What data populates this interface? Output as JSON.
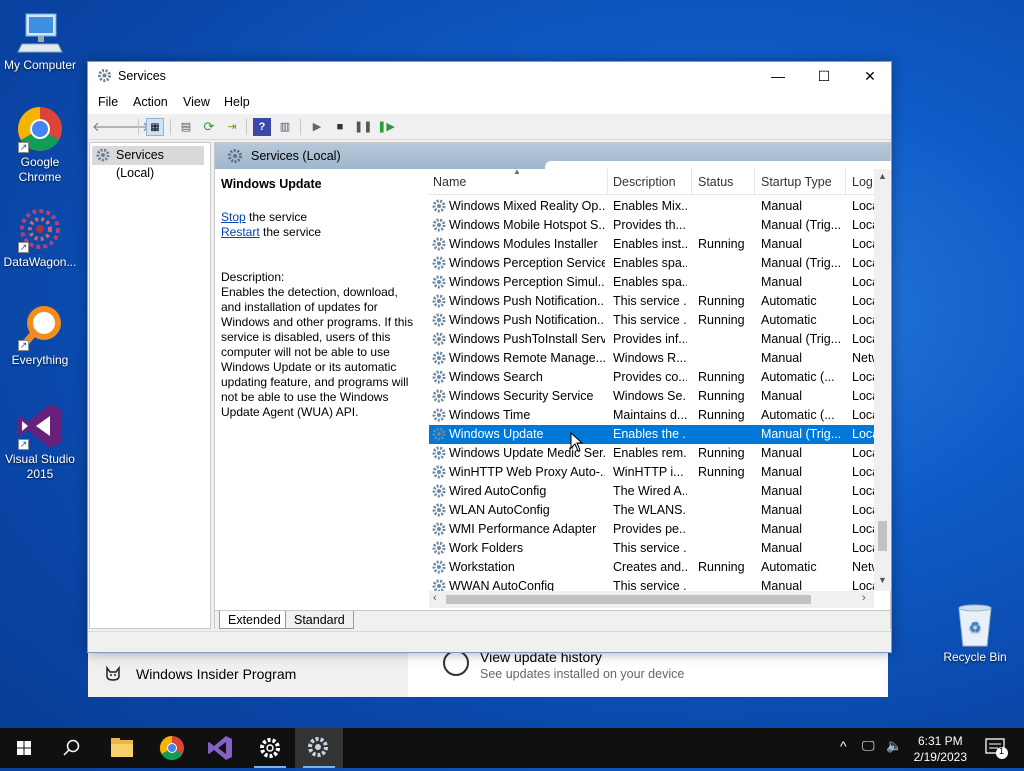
{
  "desktop": {
    "icons": [
      {
        "label": "My Computer",
        "icon": "computer-icon"
      },
      {
        "label": "Google Chrome",
        "icon": "chrome-icon"
      },
      {
        "label": "DataWagon...",
        "icon": "datawagon-icon"
      },
      {
        "label": "Everything",
        "icon": "everything-search-icon"
      },
      {
        "label": "Visual Studio 2015",
        "icon": "visual-studio-icon"
      },
      {
        "label": "Recycle Bin",
        "icon": "recycle-bin-icon"
      }
    ]
  },
  "settings_window": {
    "left_item": "Windows Insider Program",
    "history_title": "View update history",
    "history_subtitle": "See updates installed on your device"
  },
  "services_window": {
    "title": "Services",
    "menu": [
      "File",
      "Action",
      "View",
      "Help"
    ],
    "tree_item": "Services (Local)",
    "pane_title": "Services (Local)",
    "selected_service": {
      "name": "Windows Update",
      "stop_link": "Stop",
      "stop_rest": " the service",
      "restart_link": "Restart",
      "restart_rest": " the service",
      "description_label": "Description:",
      "description": "Enables the detection, download, and installation of updates for Windows and other programs. If this service is disabled, users of this computer will not be able to use Windows Update or its automatic updating feature, and programs will not be able to use the Windows Update Agent (WUA) API."
    },
    "columns": [
      "Name",
      "Description",
      "Status",
      "Startup Type",
      "Log"
    ],
    "rows": [
      {
        "name": "Windows Mixed Reality Op...",
        "desc": "Enables Mix...",
        "status": "",
        "startup": "Manual",
        "log": "Loca"
      },
      {
        "name": "Windows Mobile Hotspot S...",
        "desc": "Provides th...",
        "status": "",
        "startup": "Manual (Trig...",
        "log": "Loca"
      },
      {
        "name": "Windows Modules Installer",
        "desc": "Enables inst...",
        "status": "Running",
        "startup": "Manual",
        "log": "Loca"
      },
      {
        "name": "Windows Perception Service",
        "desc": "Enables spa...",
        "status": "",
        "startup": "Manual (Trig...",
        "log": "Loca"
      },
      {
        "name": "Windows Perception Simul...",
        "desc": "Enables spa...",
        "status": "",
        "startup": "Manual",
        "log": "Loca"
      },
      {
        "name": "Windows Push Notification...",
        "desc": "This service ...",
        "status": "Running",
        "startup": "Automatic",
        "log": "Loca"
      },
      {
        "name": "Windows Push Notification...",
        "desc": "This service ...",
        "status": "Running",
        "startup": "Automatic",
        "log": "Loca"
      },
      {
        "name": "Windows PushToInstall Serv...",
        "desc": "Provides inf...",
        "status": "",
        "startup": "Manual (Trig...",
        "log": "Loca"
      },
      {
        "name": "Windows Remote Manage...",
        "desc": "Windows R...",
        "status": "",
        "startup": "Manual",
        "log": "Netw"
      },
      {
        "name": "Windows Search",
        "desc": "Provides co...",
        "status": "Running",
        "startup": "Automatic (...",
        "log": "Loca"
      },
      {
        "name": "Windows Security Service",
        "desc": "Windows Se...",
        "status": "Running",
        "startup": "Manual",
        "log": "Loca"
      },
      {
        "name": "Windows Time",
        "desc": "Maintains d...",
        "status": "Running",
        "startup": "Automatic (...",
        "log": "Loca"
      },
      {
        "name": "Windows Update",
        "desc": "Enables the ...",
        "status": "",
        "startup": "Manual (Trig...",
        "log": "Loca"
      },
      {
        "name": "Windows Update Medic Ser...",
        "desc": "Enables rem...",
        "status": "Running",
        "startup": "Manual",
        "log": "Loca"
      },
      {
        "name": "WinHTTP Web Proxy Auto-...",
        "desc": "WinHTTP i...",
        "status": "Running",
        "startup": "Manual",
        "log": "Loca"
      },
      {
        "name": "Wired AutoConfig",
        "desc": "The Wired A...",
        "status": "",
        "startup": "Manual",
        "log": "Loca"
      },
      {
        "name": "WLAN AutoConfig",
        "desc": "The WLANS...",
        "status": "",
        "startup": "Manual",
        "log": "Loca"
      },
      {
        "name": "WMI Performance Adapter",
        "desc": "Provides pe...",
        "status": "",
        "startup": "Manual",
        "log": "Loca"
      },
      {
        "name": "Work Folders",
        "desc": "This service ...",
        "status": "",
        "startup": "Manual",
        "log": "Loca"
      },
      {
        "name": "Workstation",
        "desc": "Creates and...",
        "status": "Running",
        "startup": "Automatic",
        "log": "Netw"
      },
      {
        "name": "WWAN AutoConfig",
        "desc": "This service ...",
        "status": "",
        "startup": "Manual",
        "log": "Loca"
      }
    ],
    "tabs": [
      "Extended",
      "Standard"
    ]
  },
  "taskbar": {
    "time": "6:31 PM",
    "date": "2/19/2023",
    "notification_count": "1"
  },
  "colors": {
    "selection": "#0078d7",
    "link": "#0645ad"
  }
}
